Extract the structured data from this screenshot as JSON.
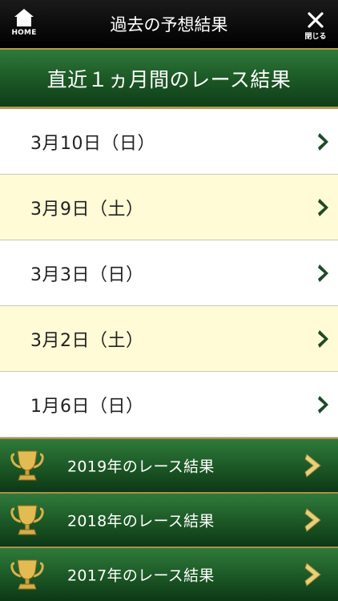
{
  "header": {
    "title": "過去の予想結果",
    "home_label": "HOME",
    "close_label": "閉じる"
  },
  "section": {
    "title": "直近１ヵ月間のレース結果"
  },
  "dates": [
    {
      "label": "3月10日（日）"
    },
    {
      "label": "3月9日（土）"
    },
    {
      "label": "3月3日（日）"
    },
    {
      "label": "3月2日（土）"
    },
    {
      "label": "1月6日（日）"
    }
  ],
  "years": [
    {
      "label": "2019年のレース結果"
    },
    {
      "label": "2018年のレース結果"
    },
    {
      "label": "2017年のレース結果"
    }
  ],
  "icons": {
    "home": "home-icon",
    "close": "close-icon",
    "chevron": "chevron-right-icon",
    "trophy": "trophy-icon"
  },
  "colors": {
    "green": "#1e5c28",
    "gold": "#b49a4a",
    "cream": "#fffbd6",
    "chevron_dark": "#1f4a25"
  }
}
